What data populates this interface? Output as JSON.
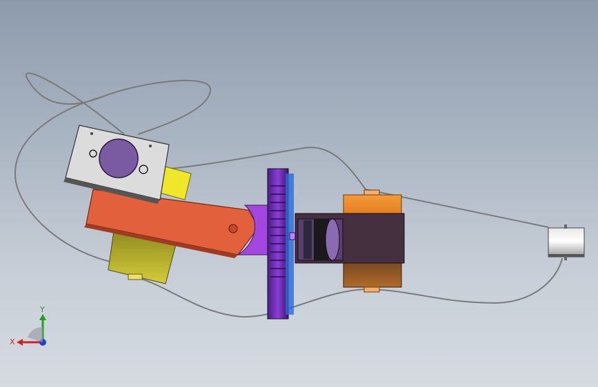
{
  "triad": {
    "x_label": "X",
    "y_label": "Y"
  },
  "colors": {
    "background_top": "#8d9bac",
    "background_bottom": "#d6dbe1",
    "arm": "#e2603c",
    "gear": "#6a2fa0",
    "housing": "#45303f",
    "orange_block": "#f08a2a",
    "olive_block": "#b8b02a",
    "yellow_block": "#f0e62a",
    "wire": "#7a7a7a",
    "axis_x": "#d42020",
    "axis_y": "#20a020",
    "axis_z": "#2040d0"
  }
}
